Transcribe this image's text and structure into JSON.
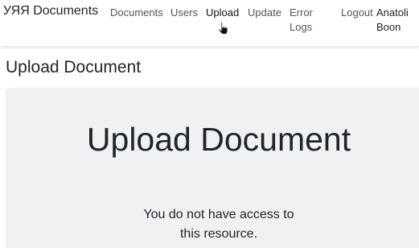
{
  "navbar": {
    "brand": "УЯЯ Documents",
    "links": {
      "documents": "Documents",
      "users": "Users",
      "upload": "Upload",
      "update": "Update",
      "error_logs": "Error Logs",
      "logout": "Logout"
    },
    "user_name": "Anatoli Boon",
    "active_link": "upload"
  },
  "page": {
    "heading": "Upload Document"
  },
  "jumbotron": {
    "title": "Upload Document",
    "message": "You do not have access to this resource."
  },
  "colors": {
    "navbar_bg": "#ffffff",
    "jumbotron_bg": "#f0f1f2",
    "text": "#212529",
    "nav_link": "#555555"
  },
  "icons": {
    "cursor": "hand-pointer-icon"
  }
}
